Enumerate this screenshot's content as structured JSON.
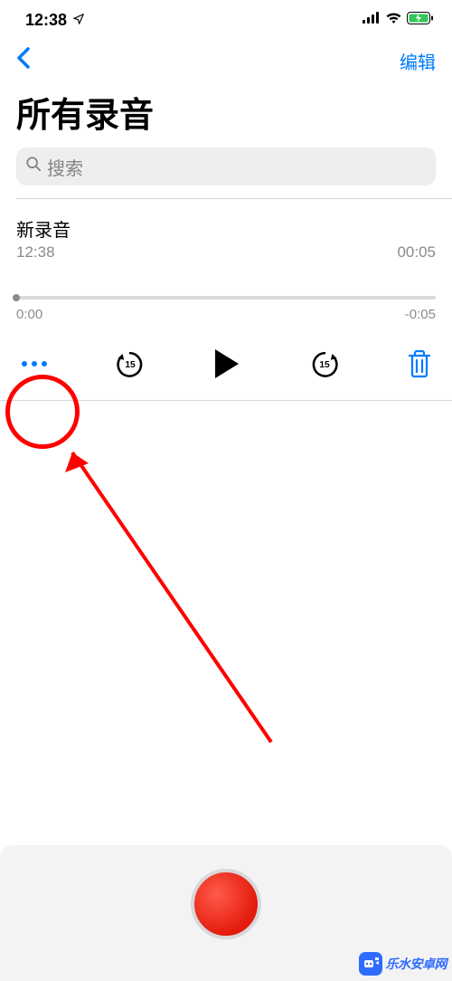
{
  "status": {
    "time": "12:38"
  },
  "nav": {
    "edit_label": "编辑"
  },
  "page": {
    "title": "所有录音"
  },
  "search": {
    "placeholder": "搜索"
  },
  "recording": {
    "title": "新录音",
    "time": "12:38",
    "duration": "00:05"
  },
  "scrubber": {
    "elapsed": "0:00",
    "remaining": "-0:05"
  },
  "controls": {
    "skip_seconds": "15"
  },
  "watermark": {
    "site": "乐水安卓网"
  }
}
